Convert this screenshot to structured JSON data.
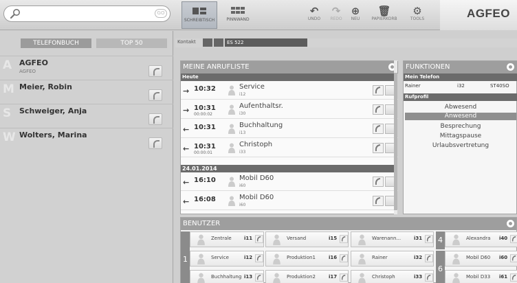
{
  "toolbar": {
    "search": {
      "placeholder": "",
      "clear_label": "GO"
    },
    "views": [
      {
        "label": "SCHREIBTISCH"
      },
      {
        "label": "PINNWAND"
      }
    ],
    "actions": [
      {
        "label": "UNDO",
        "icon": "undo-icon"
      },
      {
        "label": "REDO",
        "icon": "redo-icon"
      },
      {
        "label": "NEU",
        "icon": "plus-icon"
      },
      {
        "label": "PAPIERKORB",
        "icon": "trash-icon"
      },
      {
        "label": "TOOLS",
        "icon": "gear-icon"
      }
    ],
    "brand": "AGFEO"
  },
  "phonebook": {
    "tabs": [
      "TELEFONBUCH",
      "TOP 50"
    ],
    "contacts": [
      {
        "letter": "A",
        "name": "AGFEO",
        "sub": "AGFEO"
      },
      {
        "letter": "M",
        "name": "Meier, Robin",
        "sub": ""
      },
      {
        "letter": "S",
        "name": "Schweiger, Anja",
        "sub": ""
      },
      {
        "letter": "W",
        "name": "Wolters, Marina",
        "sub": ""
      }
    ]
  },
  "kontakt": {
    "label": "Kontakt",
    "device": "ES 522"
  },
  "calllist": {
    "title": "MEINE ANRUFLISTE",
    "today_label": "Heute",
    "today": [
      {
        "dir": "→",
        "time": "10:32",
        "duration": "",
        "name": "Service",
        "ext": "i12"
      },
      {
        "dir": "→",
        "time": "10:31",
        "duration": "00:00:02",
        "name": "Aufenthaltsr.",
        "ext": "i30"
      },
      {
        "dir": "←",
        "time": "10:31",
        "duration": "",
        "name": "Buchhaltung",
        "ext": "i13"
      },
      {
        "dir": "←",
        "time": "10:31",
        "duration": "00:00:01",
        "name": "Christoph",
        "ext": "i33"
      }
    ],
    "date_label": "24.01.2014",
    "earlier": [
      {
        "dir": "←",
        "time": "16:10",
        "duration": "",
        "name": "Mobil D60",
        "ext": "i60"
      },
      {
        "dir": "←",
        "time": "16:08",
        "duration": "",
        "name": "Mobil D60",
        "ext": "i60"
      }
    ]
  },
  "functions": {
    "title": "FUNKTIONEN",
    "my_phone_label": "Mein Telefon",
    "phone": {
      "name": "Rainer",
      "ext": "i32",
      "model": "ST40SO"
    },
    "profile_label": "Rufprofil",
    "profiles": [
      "Abwesend",
      "Anwesend",
      "Besprechung",
      "Mittagspause",
      "Urlaubsvertretung"
    ],
    "active_profile_index": 1
  },
  "users": {
    "title": "BENUTZER",
    "groups": [
      {
        "num": "1",
        "col": 0,
        "members": [
          {
            "name": "Zentrale",
            "ext": "i11"
          },
          {
            "name": "Service",
            "ext": "i12"
          },
          {
            "name": "Buchhaltung",
            "ext": "i13"
          }
        ]
      },
      {
        "num": "",
        "col": 1,
        "members": [
          {
            "name": "Versand",
            "ext": "i15"
          },
          {
            "name": "Produktion1",
            "ext": "i16"
          },
          {
            "name": "Produktion2",
            "ext": "i17"
          }
        ]
      },
      {
        "num": "",
        "col": 2,
        "members": [
          {
            "name": "Warenann...",
            "ext": "i31"
          },
          {
            "name": "Rainer",
            "ext": "i32"
          },
          {
            "name": "Christoph",
            "ext": "i33"
          }
        ]
      },
      {
        "num": "4",
        "col": 3,
        "members": [
          {
            "name": "Alexandra",
            "ext": "i40"
          }
        ]
      },
      {
        "num": "6",
        "col": 3,
        "members": [
          {
            "name": "Mobil D60",
            "ext": "i60"
          },
          {
            "name": "Mobil D33",
            "ext": "i61"
          }
        ]
      }
    ]
  },
  "colors": {
    "header": "#9e9e9e",
    "section": "#6b6b6b",
    "panel": "#d1d1d1"
  }
}
